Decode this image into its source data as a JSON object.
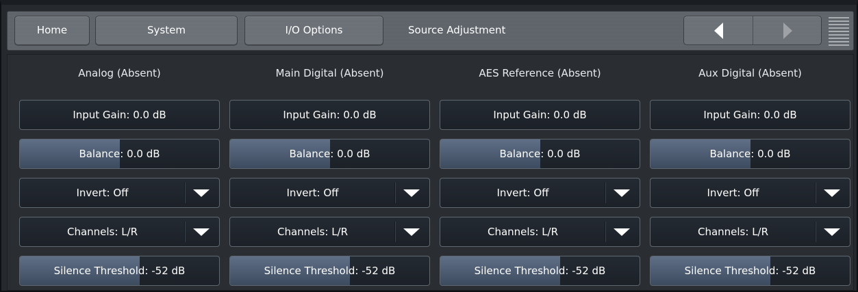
{
  "nav": {
    "tabs": [
      {
        "label": "Home"
      },
      {
        "label": "System"
      },
      {
        "label": "I/O Options"
      }
    ],
    "current": "Source Adjustment",
    "prev_icon": "triangle-left-icon",
    "next_icon": "triangle-right-icon",
    "menu_icon": "hamburger-menu-icon"
  },
  "colors": {
    "slider_fill": "#5f6f86",
    "control_bg": "#1f252c",
    "toolbar_bg": "#62676d"
  },
  "sources": [
    {
      "title": "Analog (Absent)",
      "input_gain": "Input Gain: 0.0 dB",
      "input_gain_level": 0.0,
      "balance": "Balance: 0.0 dB",
      "balance_level": 0.5,
      "invert": "Invert: Off",
      "channels": "Channels: L/R",
      "silence": "Silence Threshold: -52 dB",
      "silence_level": 0.6
    },
    {
      "title": "Main Digital (Absent)",
      "input_gain": "Input Gain: 0.0 dB",
      "input_gain_level": 0.0,
      "balance": "Balance: 0.0 dB",
      "balance_level": 0.5,
      "invert": "Invert: Off",
      "channels": "Channels: L/R",
      "silence": "Silence Threshold: -52 dB",
      "silence_level": 0.6
    },
    {
      "title": "AES Reference (Absent)",
      "input_gain": "Input Gain: 0.0 dB",
      "input_gain_level": 0.0,
      "balance": "Balance: 0.0 dB",
      "balance_level": 0.5,
      "invert": "Invert: Off",
      "channels": "Channels: L/R",
      "silence": "Silence Threshold: -52 dB",
      "silence_level": 0.6
    },
    {
      "title": "Aux Digital (Absent)",
      "input_gain": "Input Gain: 0.0 dB",
      "input_gain_level": 0.0,
      "balance": "Balance: 0.0 dB",
      "balance_level": 0.5,
      "invert": "Invert: Off",
      "channels": "Channels: L/R",
      "silence": "Silence Threshold: -52 dB",
      "silence_level": 0.6
    }
  ]
}
